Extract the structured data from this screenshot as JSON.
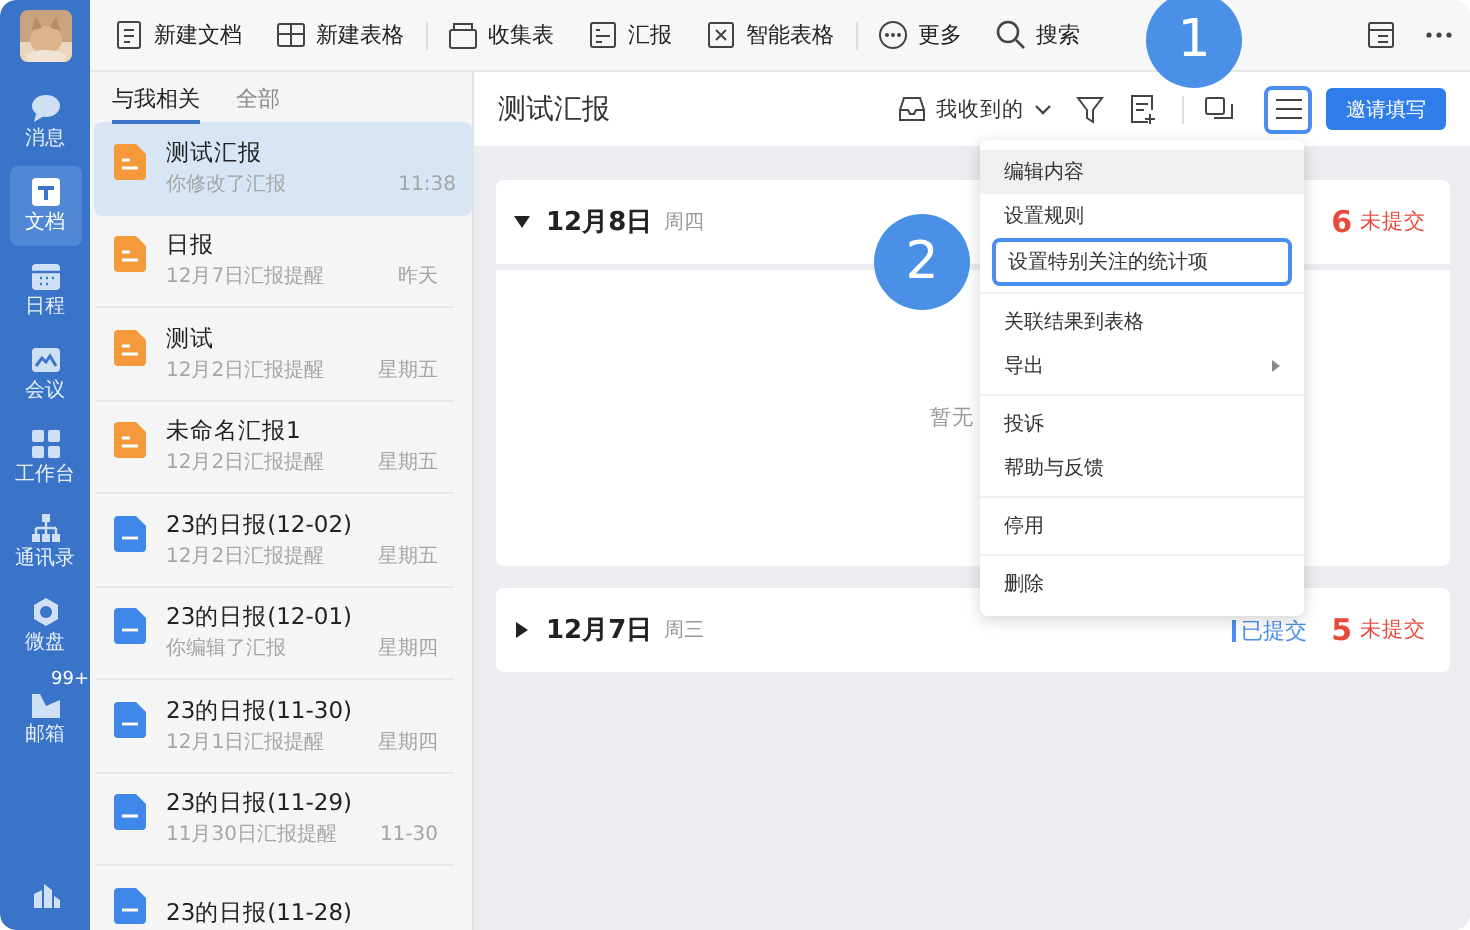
{
  "sidebar": {
    "items": [
      {
        "label": "消息",
        "selected": false
      },
      {
        "label": "文档",
        "selected": true
      },
      {
        "label": "日程",
        "selected": false
      },
      {
        "label": "会议",
        "selected": false
      },
      {
        "label": "工作台",
        "selected": false
      },
      {
        "label": "通讯录",
        "selected": false
      },
      {
        "label": "微盘",
        "selected": false
      },
      {
        "label": "邮箱",
        "selected": false,
        "badge": "99+"
      }
    ]
  },
  "toolbar": {
    "buttons": [
      {
        "label": "新建文档"
      },
      {
        "label": "新建表格"
      },
      {
        "label": "收集表"
      },
      {
        "label": "汇报"
      },
      {
        "label": "智能表格"
      },
      {
        "label": "更多"
      },
      {
        "label": "搜索"
      }
    ]
  },
  "list": {
    "tabs": [
      {
        "label": "与我相关",
        "selected": true
      },
      {
        "label": "全部",
        "selected": false
      }
    ],
    "items": [
      {
        "kind": "report",
        "title": "测试汇报",
        "subtitle": "你修改了汇报",
        "time": "11:38",
        "selected": true
      },
      {
        "kind": "report",
        "title": "日报",
        "subtitle": "12月7日汇报提醒",
        "time": "昨天",
        "selected": false
      },
      {
        "kind": "report",
        "title": "测试",
        "subtitle": "12月2日汇报提醒",
        "time": "星期五",
        "selected": false
      },
      {
        "kind": "report",
        "title": "未命名汇报1",
        "subtitle": "12月2日汇报提醒",
        "time": "星期五",
        "selected": false
      },
      {
        "kind": "doc",
        "title": "23的日报(12-02)",
        "subtitle": "12月2日汇报提醒",
        "time": "星期五",
        "selected": false
      },
      {
        "kind": "doc",
        "title": "23的日报(12-01)",
        "subtitle": "你编辑了汇报",
        "time": "星期四",
        "selected": false
      },
      {
        "kind": "doc",
        "title": "23的日报(11-30)",
        "subtitle": "12月1日汇报提醒",
        "time": "星期四",
        "selected": false
      },
      {
        "kind": "doc",
        "title": "23的日报(11-29)",
        "subtitle": "11月30日汇报提醒",
        "time": "11-30",
        "selected": false
      },
      {
        "kind": "doc",
        "title": "23的日报(11-28)",
        "selected": false
      }
    ]
  },
  "main": {
    "title": "测试汇报",
    "filter": "我收到的",
    "invite_button": "邀请填写",
    "menu_button": {
      "highlighted": true
    },
    "days": [
      {
        "date": "12月8日",
        "weekday": "周四",
        "expanded": true,
        "not_submitted_count": "6",
        "not_submitted_label": "未提交",
        "empty_text": "暂无"
      },
      {
        "date": "12月7日",
        "weekday": "周三",
        "expanded": false,
        "submitted_label": "已提交",
        "not_submitted_count": "5",
        "not_submitted_label": "未提交"
      }
    ]
  },
  "menu": {
    "groups": [
      [
        {
          "label": "编辑内容",
          "hovered": true,
          "highlighted": false
        },
        {
          "label": "设置规则",
          "hovered": false,
          "highlighted": false
        },
        {
          "label": "设置特别关注的统计项",
          "hovered": false,
          "highlighted": true
        }
      ],
      [
        {
          "label": "关联结果到表格",
          "hovered": false,
          "highlighted": false
        },
        {
          "label": "导出",
          "hovered": false,
          "highlighted": false,
          "submenu": true
        }
      ],
      [
        {
          "label": "投诉",
          "hovered": false,
          "highlighted": false
        },
        {
          "label": "帮助与反馈",
          "hovered": false,
          "highlighted": false
        }
      ],
      [
        {
          "label": "停用",
          "hovered": false,
          "highlighted": false
        }
      ],
      [
        {
          "label": "删除",
          "hovered": false,
          "highlighted": false
        }
      ]
    ]
  },
  "annotations": [
    {
      "label": "1"
    },
    {
      "label": "2"
    }
  ]
}
